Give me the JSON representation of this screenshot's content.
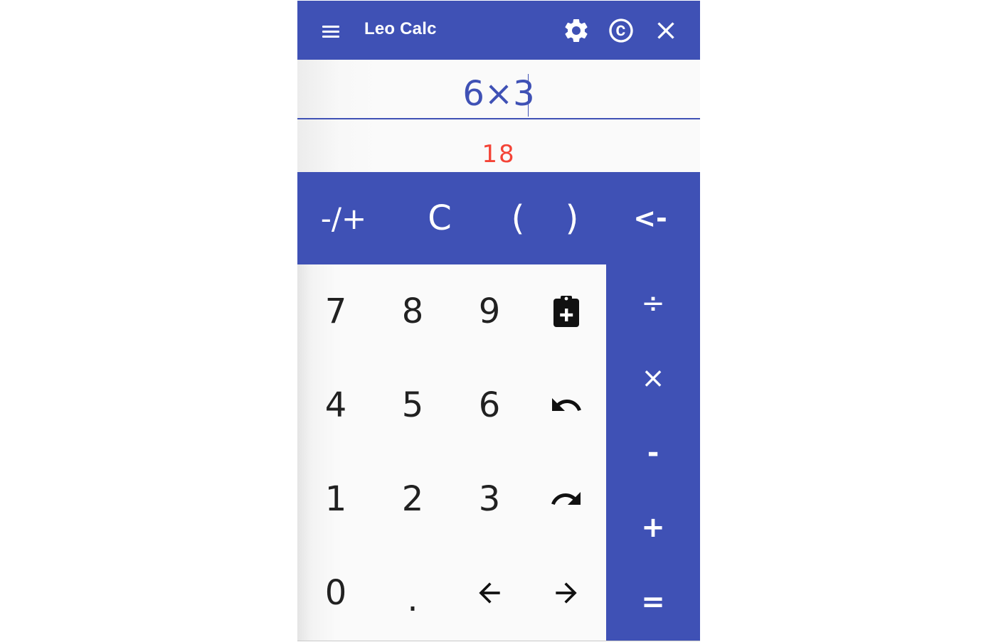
{
  "header": {
    "title": "Leo Calc",
    "icons": [
      "menu-icon",
      "gear-icon",
      "copyright-icon",
      "close-icon"
    ]
  },
  "display": {
    "expression": "6×3",
    "result": "18"
  },
  "operators_top": {
    "sign": "-/+",
    "clear": "C",
    "open_paren": "(",
    "close_paren": ")",
    "backspace": "<-"
  },
  "operators_side": {
    "divide": "÷",
    "multiply": "×",
    "subtract": "-",
    "add": "+",
    "equals": "="
  },
  "keypad": {
    "k7": "7",
    "k8": "8",
    "k9": "9",
    "k4": "4",
    "k5": "5",
    "k6": "6",
    "k1": "1",
    "k2": "2",
    "k3": "3",
    "k0": "0",
    "dot": "."
  },
  "colors": {
    "primary": "#3f51b5",
    "result": "#f44336",
    "background": "#fafafa"
  }
}
